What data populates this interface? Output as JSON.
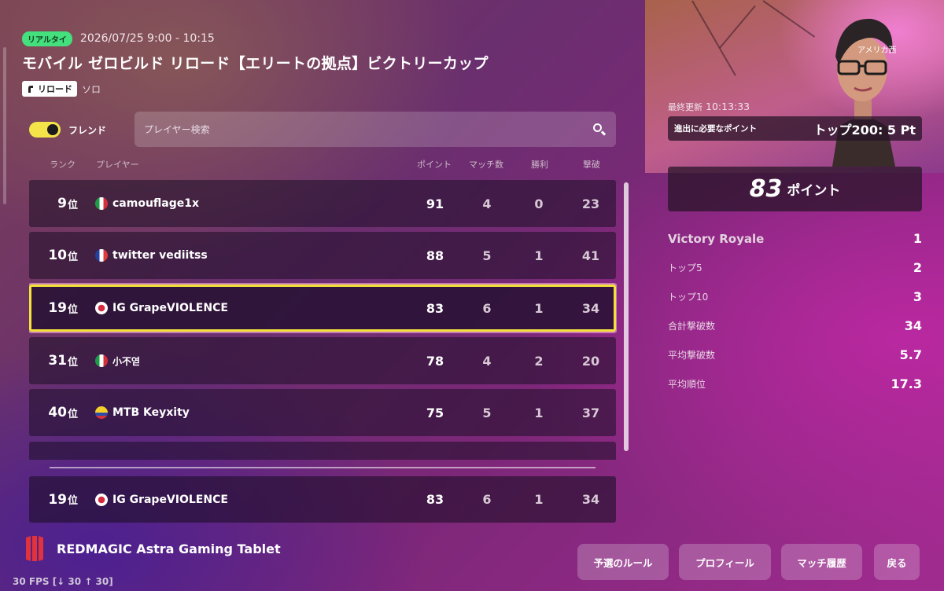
{
  "header": {
    "badge": "リアルタイ",
    "date_range": "2026/07/25 9:00 - 10:15",
    "title": "モバイル ゼロビルド リロード【エリートの拠点】ビクトリーカップ",
    "tag_reload": "リロード",
    "tag_mode": "ソロ"
  },
  "controls": {
    "friend_label": "フレンド",
    "search_placeholder": "プレイヤー検索"
  },
  "columns": {
    "rank": "ランク",
    "player": "プレイヤー",
    "points": "ポイント",
    "matches": "マッチ数",
    "wins": "勝利",
    "eliminations": "撃破"
  },
  "leaderboard": [
    {
      "rank": "9",
      "rank_suffix": "位",
      "flag": "italy-flag",
      "player": "camouflage1x",
      "points": "91",
      "matches": "4",
      "wins": "0",
      "eliminations": "23"
    },
    {
      "rank": "10",
      "rank_suffix": "位",
      "flag": "france-flag",
      "player": "twitter vediitss",
      "points": "88",
      "matches": "5",
      "wins": "1",
      "eliminations": "41"
    },
    {
      "rank": "19",
      "rank_suffix": "位",
      "flag": "japan-flag",
      "player": "IG GrapeVIOLENCE",
      "points": "83",
      "matches": "6",
      "wins": "1",
      "eliminations": "34"
    },
    {
      "rank": "31",
      "rank_suffix": "位",
      "flag": "italy-flag",
      "player": "小不엳",
      "points": "78",
      "matches": "4",
      "wins": "2",
      "eliminations": "20"
    },
    {
      "rank": "40",
      "rank_suffix": "位",
      "flag": "colombia-flag",
      "player": "MTB Keyxity",
      "points": "75",
      "matches": "5",
      "wins": "1",
      "eliminations": "37"
    }
  ],
  "own_row": {
    "rank": "19",
    "rank_suffix": "位",
    "flag": "japan-flag",
    "player": "IG GrapeVIOLENCE",
    "points": "83",
    "matches": "6",
    "wins": "1",
    "eliminations": "34"
  },
  "side": {
    "region": "アメリカ西",
    "last_updated_label": "最終更新",
    "last_updated_time": "10:13:33",
    "advance_label": "進出に必要なポイント",
    "advance_value": "トップ200: 5 Pt",
    "points_value": "83",
    "points_unit": "ポイント",
    "stats": [
      {
        "label": "Victory Royale",
        "value": "1"
      },
      {
        "label": "トップ5",
        "value": "2"
      },
      {
        "label": "トップ10",
        "value": "3"
      },
      {
        "label": "合計撃破数",
        "value": "34"
      },
      {
        "label": "平均撃破数",
        "value": "5.7"
      },
      {
        "label": "平均順位",
        "value": "17.3"
      }
    ]
  },
  "buttons": {
    "rules": "予選のルール",
    "profile": "プロフィール",
    "history": "マッチ履歴",
    "back": "戻る"
  },
  "device": {
    "brand": "REDMAGIC Astra Gaming Tablet",
    "fps": "30 FPS [↓ 30 ↑ 30]"
  },
  "colors": {
    "highlight_border": "#f3e23a",
    "live_badge": "#44e07e",
    "toggle_on": "#f4e44a"
  }
}
